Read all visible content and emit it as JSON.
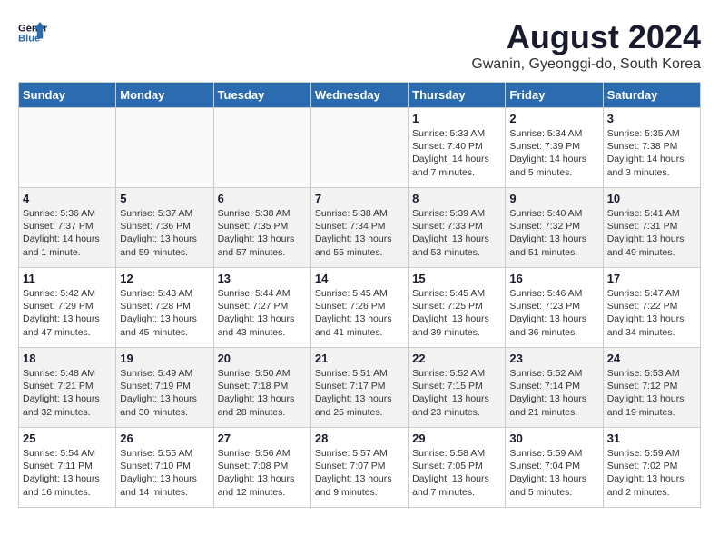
{
  "logo": {
    "line1": "General",
    "line2": "Blue"
  },
  "title": "August 2024",
  "subtitle": "Gwanin, Gyeonggi-do, South Korea",
  "days_of_week": [
    "Sunday",
    "Monday",
    "Tuesday",
    "Wednesday",
    "Thursday",
    "Friday",
    "Saturday"
  ],
  "weeks": [
    [
      {
        "day": "",
        "info": ""
      },
      {
        "day": "",
        "info": ""
      },
      {
        "day": "",
        "info": ""
      },
      {
        "day": "",
        "info": ""
      },
      {
        "day": "1",
        "info": "Sunrise: 5:33 AM\nSunset: 7:40 PM\nDaylight: 14 hours\nand 7 minutes."
      },
      {
        "day": "2",
        "info": "Sunrise: 5:34 AM\nSunset: 7:39 PM\nDaylight: 14 hours\nand 5 minutes."
      },
      {
        "day": "3",
        "info": "Sunrise: 5:35 AM\nSunset: 7:38 PM\nDaylight: 14 hours\nand 3 minutes."
      }
    ],
    [
      {
        "day": "4",
        "info": "Sunrise: 5:36 AM\nSunset: 7:37 PM\nDaylight: 14 hours\nand 1 minute."
      },
      {
        "day": "5",
        "info": "Sunrise: 5:37 AM\nSunset: 7:36 PM\nDaylight: 13 hours\nand 59 minutes."
      },
      {
        "day": "6",
        "info": "Sunrise: 5:38 AM\nSunset: 7:35 PM\nDaylight: 13 hours\nand 57 minutes."
      },
      {
        "day": "7",
        "info": "Sunrise: 5:38 AM\nSunset: 7:34 PM\nDaylight: 13 hours\nand 55 minutes."
      },
      {
        "day": "8",
        "info": "Sunrise: 5:39 AM\nSunset: 7:33 PM\nDaylight: 13 hours\nand 53 minutes."
      },
      {
        "day": "9",
        "info": "Sunrise: 5:40 AM\nSunset: 7:32 PM\nDaylight: 13 hours\nand 51 minutes."
      },
      {
        "day": "10",
        "info": "Sunrise: 5:41 AM\nSunset: 7:31 PM\nDaylight: 13 hours\nand 49 minutes."
      }
    ],
    [
      {
        "day": "11",
        "info": "Sunrise: 5:42 AM\nSunset: 7:29 PM\nDaylight: 13 hours\nand 47 minutes."
      },
      {
        "day": "12",
        "info": "Sunrise: 5:43 AM\nSunset: 7:28 PM\nDaylight: 13 hours\nand 45 minutes."
      },
      {
        "day": "13",
        "info": "Sunrise: 5:44 AM\nSunset: 7:27 PM\nDaylight: 13 hours\nand 43 minutes."
      },
      {
        "day": "14",
        "info": "Sunrise: 5:45 AM\nSunset: 7:26 PM\nDaylight: 13 hours\nand 41 minutes."
      },
      {
        "day": "15",
        "info": "Sunrise: 5:45 AM\nSunset: 7:25 PM\nDaylight: 13 hours\nand 39 minutes."
      },
      {
        "day": "16",
        "info": "Sunrise: 5:46 AM\nSunset: 7:23 PM\nDaylight: 13 hours\nand 36 minutes."
      },
      {
        "day": "17",
        "info": "Sunrise: 5:47 AM\nSunset: 7:22 PM\nDaylight: 13 hours\nand 34 minutes."
      }
    ],
    [
      {
        "day": "18",
        "info": "Sunrise: 5:48 AM\nSunset: 7:21 PM\nDaylight: 13 hours\nand 32 minutes."
      },
      {
        "day": "19",
        "info": "Sunrise: 5:49 AM\nSunset: 7:19 PM\nDaylight: 13 hours\nand 30 minutes."
      },
      {
        "day": "20",
        "info": "Sunrise: 5:50 AM\nSunset: 7:18 PM\nDaylight: 13 hours\nand 28 minutes."
      },
      {
        "day": "21",
        "info": "Sunrise: 5:51 AM\nSunset: 7:17 PM\nDaylight: 13 hours\nand 25 minutes."
      },
      {
        "day": "22",
        "info": "Sunrise: 5:52 AM\nSunset: 7:15 PM\nDaylight: 13 hours\nand 23 minutes."
      },
      {
        "day": "23",
        "info": "Sunrise: 5:52 AM\nSunset: 7:14 PM\nDaylight: 13 hours\nand 21 minutes."
      },
      {
        "day": "24",
        "info": "Sunrise: 5:53 AM\nSunset: 7:12 PM\nDaylight: 13 hours\nand 19 minutes."
      }
    ],
    [
      {
        "day": "25",
        "info": "Sunrise: 5:54 AM\nSunset: 7:11 PM\nDaylight: 13 hours\nand 16 minutes."
      },
      {
        "day": "26",
        "info": "Sunrise: 5:55 AM\nSunset: 7:10 PM\nDaylight: 13 hours\nand 14 minutes."
      },
      {
        "day": "27",
        "info": "Sunrise: 5:56 AM\nSunset: 7:08 PM\nDaylight: 13 hours\nand 12 minutes."
      },
      {
        "day": "28",
        "info": "Sunrise: 5:57 AM\nSunset: 7:07 PM\nDaylight: 13 hours\nand 9 minutes."
      },
      {
        "day": "29",
        "info": "Sunrise: 5:58 AM\nSunset: 7:05 PM\nDaylight: 13 hours\nand 7 minutes."
      },
      {
        "day": "30",
        "info": "Sunrise: 5:59 AM\nSunset: 7:04 PM\nDaylight: 13 hours\nand 5 minutes."
      },
      {
        "day": "31",
        "info": "Sunrise: 5:59 AM\nSunset: 7:02 PM\nDaylight: 13 hours\nand 2 minutes."
      }
    ]
  ]
}
